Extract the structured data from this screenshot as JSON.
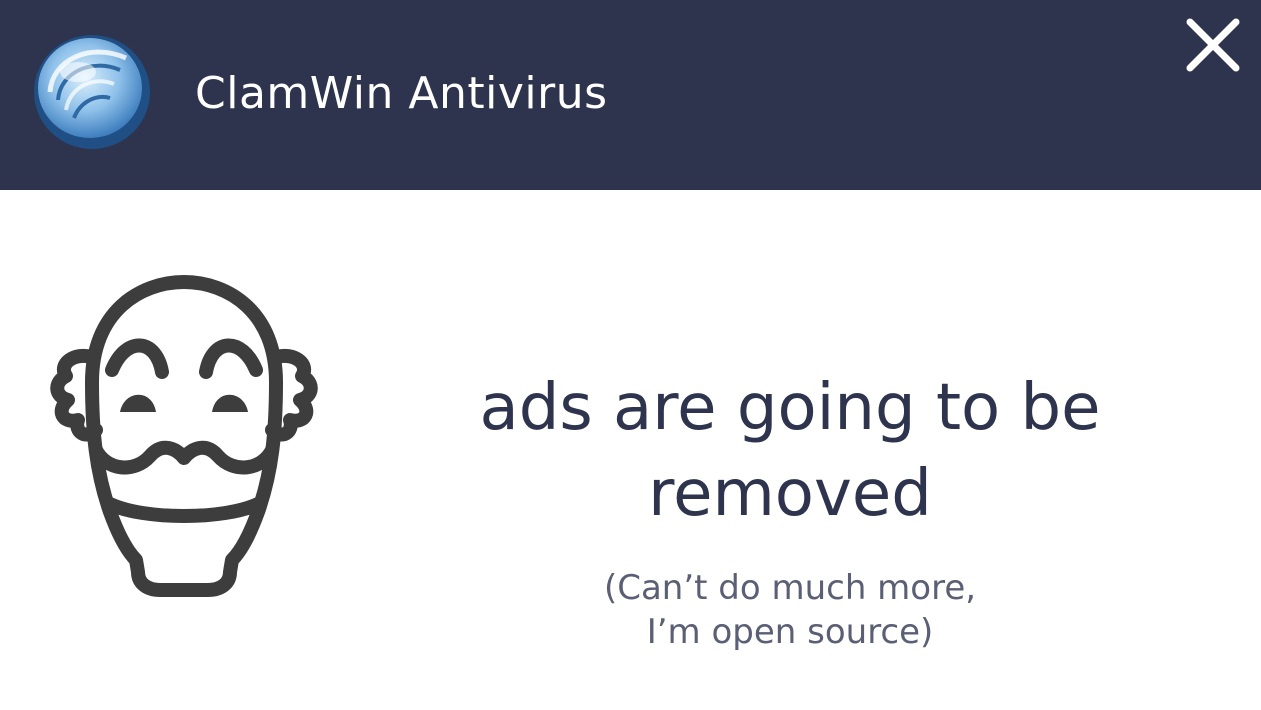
{
  "header": {
    "app_title": "ClamWin Antivirus",
    "background_color": "#2e344d",
    "logo_icon": "clamwin-shell-logo",
    "close_icon": "close-x"
  },
  "main": {
    "illustration_icon": "guy-fawkes-mask",
    "message": "ads are going to be removed",
    "submessage": "(Can’t do much more,\nI’m open source)",
    "text_color": "#2e344d"
  }
}
